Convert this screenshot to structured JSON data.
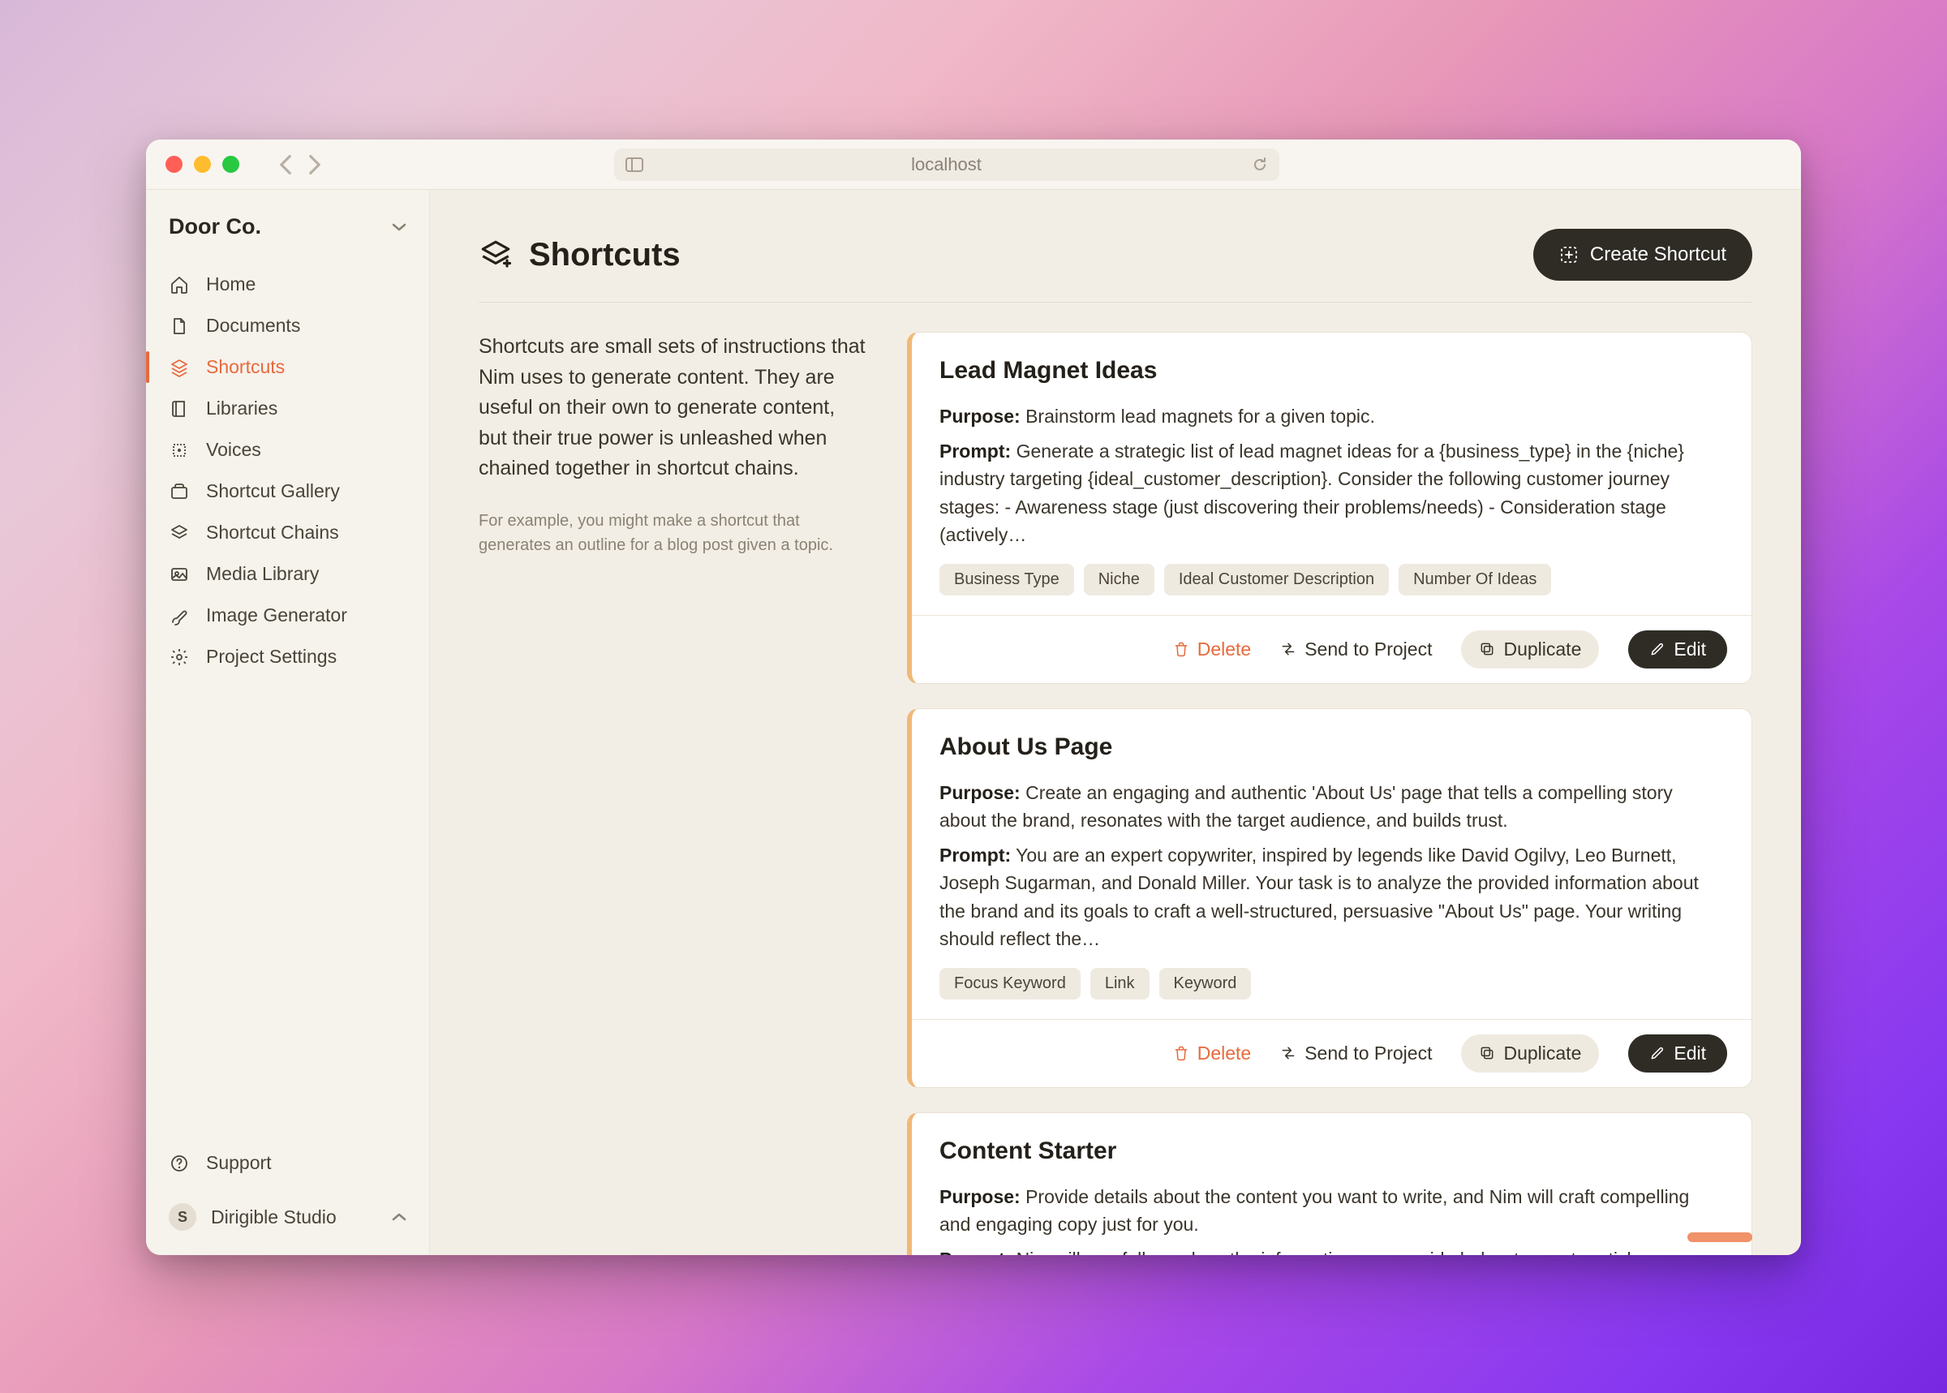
{
  "titlebar": {
    "url": "localhost"
  },
  "workspace": {
    "name": "Door Co."
  },
  "nav": {
    "items": [
      {
        "label": "Home"
      },
      {
        "label": "Documents"
      },
      {
        "label": "Shortcuts"
      },
      {
        "label": "Libraries"
      },
      {
        "label": "Voices"
      },
      {
        "label": "Shortcut Gallery"
      },
      {
        "label": "Shortcut Chains"
      },
      {
        "label": "Media Library"
      },
      {
        "label": "Image Generator"
      },
      {
        "label": "Project Settings"
      }
    ]
  },
  "support": {
    "label": "Support"
  },
  "studio": {
    "initial": "S",
    "label": "Dirigible Studio"
  },
  "page": {
    "title": "Shortcuts",
    "create_label": "Create Shortcut",
    "intro": "Shortcuts are small sets of instructions that Nim uses to generate content. They are useful on their own to generate content, but their true power is unleashed when chained together in shortcut chains.",
    "example": "For example, you might make a shortcut that generates an outline for a blog post given a topic."
  },
  "labels": {
    "purpose": "Purpose:",
    "prompt": "Prompt:",
    "delete": "Delete",
    "send": "Send to Project",
    "duplicate": "Duplicate",
    "edit": "Edit"
  },
  "cards": [
    {
      "title": "Lead Magnet Ideas",
      "purpose": "Brainstorm lead magnets for a given topic.",
      "prompt": "Generate a strategic list of lead magnet ideas for a {business_type} in the {niche} industry targeting {ideal_customer_description}. Consider the following customer journey stages: - Awareness stage (just discovering their problems/needs) - Consideration stage (actively…",
      "tags": [
        "Business Type",
        "Niche",
        "Ideal Customer Description",
        "Number Of Ideas"
      ]
    },
    {
      "title": "About Us Page",
      "purpose": "Create an engaging and authentic 'About Us' page that tells a compelling story about the brand, resonates with the target audience, and builds trust.",
      "prompt": "You are an expert copywriter, inspired by legends like David Ogilvy, Leo Burnett, Joseph Sugarman, and Donald Miller. Your task is to analyze the provided information about the brand and its goals to craft a well-structured, persuasive \"About Us\" page. Your writing should reflect the…",
      "tags": [
        "Focus Keyword",
        "Link",
        "Keyword"
      ]
    },
    {
      "title": "Content Starter",
      "purpose": "Provide details about the content you want to write, and Nim will craft compelling and engaging copy just for you.",
      "prompt": "Nim will carefully analyze the information you provide below to create articles, website pages, or social media posts that hit the mark. Fill in as many details as you can, and Nim will take care of the rest. What's the {topic} of your post? (Describe the main subject in a sentence or two",
      "tags": []
    }
  ]
}
